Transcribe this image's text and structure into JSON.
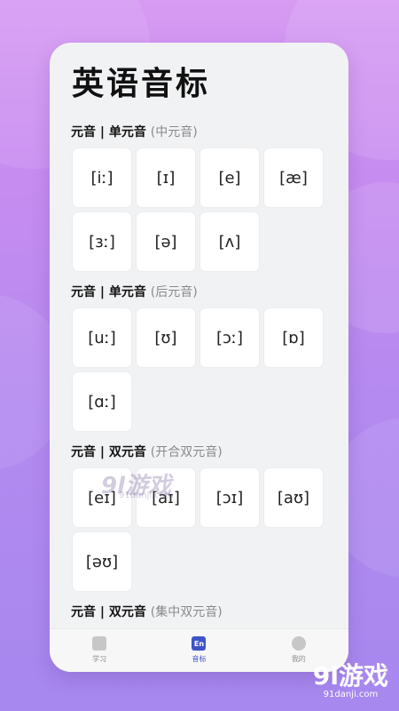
{
  "page": {
    "title": "英语音标",
    "sections": [
      {
        "heading": "元音 | 单元音",
        "note": "(中元音)",
        "symbols": [
          "[iː]",
          "[ɪ]",
          "[e]",
          "[æ]",
          "[ɜː]",
          "[ə]",
          "[ʌ]"
        ]
      },
      {
        "heading": "元音 | 单元音",
        "note": "(后元音)",
        "symbols": [
          "[uː]",
          "[ʊ]",
          "[ɔː]",
          "[ɒ]",
          "[ɑː]"
        ]
      },
      {
        "heading": "元音 | 双元音",
        "note": "(开合双元音)",
        "symbols": [
          "[eɪ]",
          "[aɪ]",
          "[ɔɪ]",
          "[aʊ]",
          "[əʊ]"
        ]
      },
      {
        "heading": "元音 | 双元音",
        "note": "(集中双元音)",
        "symbols": []
      }
    ]
  },
  "tabbar": {
    "items": [
      {
        "label": "学习",
        "icon": "book-icon",
        "active": false
      },
      {
        "label": "音标",
        "icon": "en-icon",
        "icon_text": "En",
        "active": true
      },
      {
        "label": "我的",
        "icon": "profile-icon",
        "active": false
      }
    ]
  },
  "watermark": {
    "text": "9l游戏",
    "url": "91danji.com"
  },
  "brand": {
    "text": "9l游戏",
    "url": "91danji.com"
  },
  "colors": {
    "accent": "#3f53c8",
    "background": "#f1f2f4"
  }
}
